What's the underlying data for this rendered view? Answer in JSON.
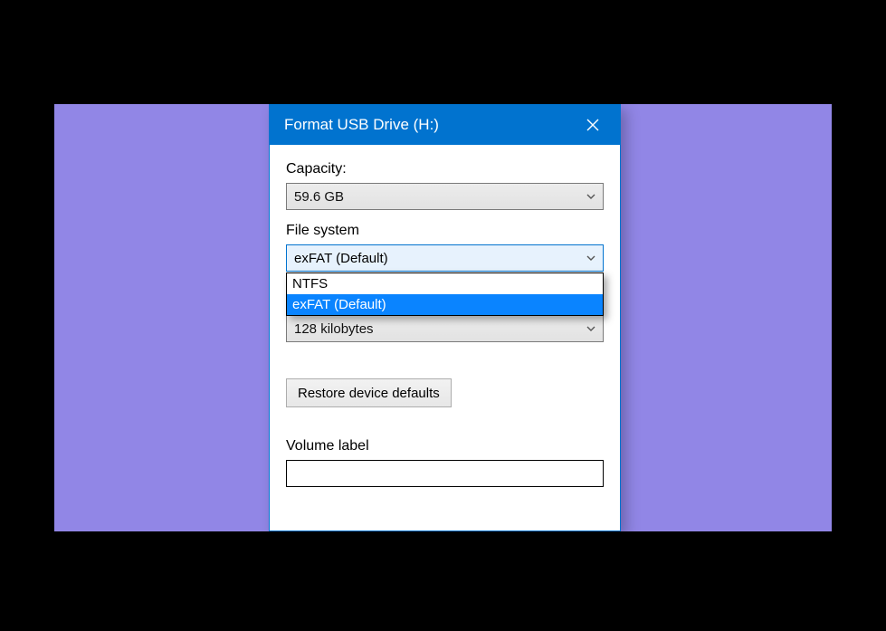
{
  "title": "Format USB Drive (H:)",
  "capacity": {
    "label": "Capacity:",
    "value": "59.6 GB"
  },
  "file_system": {
    "label": "File system",
    "selected": "exFAT (Default)",
    "options": [
      "NTFS",
      "exFAT (Default)"
    ],
    "highlighted_index": 1
  },
  "allocation": {
    "value": "128 kilobytes"
  },
  "restore_defaults_label": "Restore device defaults",
  "volume_label": {
    "label": "Volume label",
    "value": ""
  }
}
